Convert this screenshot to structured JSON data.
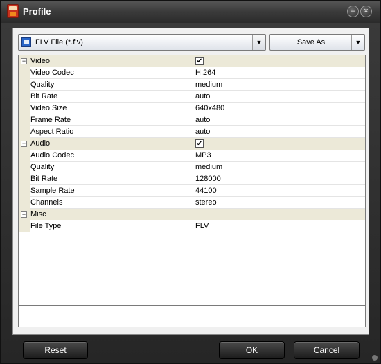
{
  "window": {
    "title": "Profile"
  },
  "format": {
    "selected": "FLV File (*.flv)"
  },
  "toolbar": {
    "save_as_label": "Save As"
  },
  "properties": [
    {
      "category": "Video",
      "checked": true,
      "items": [
        {
          "name": "Video Codec",
          "value": "H.264"
        },
        {
          "name": "Quality",
          "value": "medium"
        },
        {
          "name": "Bit Rate",
          "value": "auto"
        },
        {
          "name": "Video Size",
          "value": "640x480"
        },
        {
          "name": "Frame Rate",
          "value": "auto"
        },
        {
          "name": "Aspect Ratio",
          "value": "auto"
        }
      ]
    },
    {
      "category": "Audio",
      "checked": true,
      "items": [
        {
          "name": "Audio Codec",
          "value": "MP3"
        },
        {
          "name": "Quality",
          "value": "medium"
        },
        {
          "name": "Bit Rate",
          "value": "128000"
        },
        {
          "name": "Sample Rate",
          "value": "44100"
        },
        {
          "name": "Channels",
          "value": "stereo"
        }
      ]
    },
    {
      "category": "Misc",
      "checked": false,
      "items": [
        {
          "name": "File Type",
          "value": "FLV"
        }
      ]
    }
  ],
  "buttons": {
    "reset": "Reset",
    "ok": "OK",
    "cancel": "Cancel"
  },
  "icons": {
    "app": "app-logo-icon",
    "format": "video-file-icon",
    "minimize": "minimize-icon",
    "close": "close-icon",
    "expander": "collapse-icon",
    "dropdown": "chevron-down-icon"
  }
}
